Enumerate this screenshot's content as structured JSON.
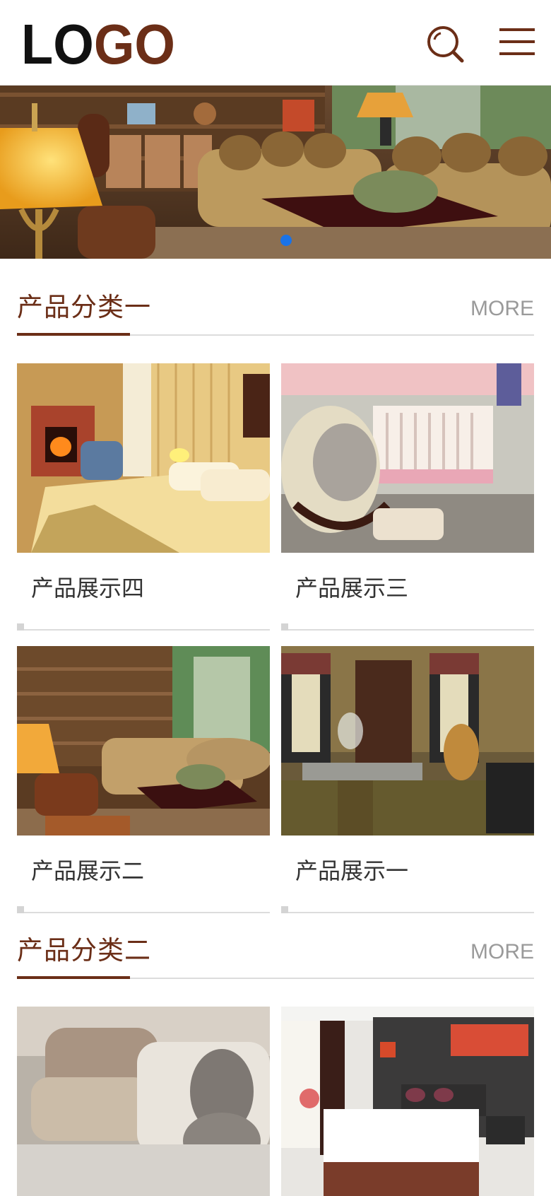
{
  "header": {
    "logo_text": "LOGO",
    "logo_colors": [
      "#111111",
      "#6b2e17"
    ],
    "search_icon": "search-icon",
    "menu_icon": "hamburger-menu-icon"
  },
  "colors": {
    "accent": "#6b2e17",
    "more_gray": "#9a9a9a",
    "banner_dot": "#1a73e8"
  },
  "sections": [
    {
      "title": "产品分类一",
      "more": "MORE",
      "products": [
        {
          "label": "产品展示四",
          "image": "bedroom-fireplace"
        },
        {
          "label": "产品展示三",
          "image": "nursery-crib"
        },
        {
          "label": "产品展示二",
          "image": "living-room-shelves"
        },
        {
          "label": "产品展示一",
          "image": "victorian-parlor"
        }
      ]
    },
    {
      "title": "产品分类二",
      "more": "MORE",
      "products": [
        {
          "label": "",
          "image": "bed-pillows-plush"
        },
        {
          "label": "",
          "image": "hotel-bedroom"
        }
      ]
    }
  ]
}
